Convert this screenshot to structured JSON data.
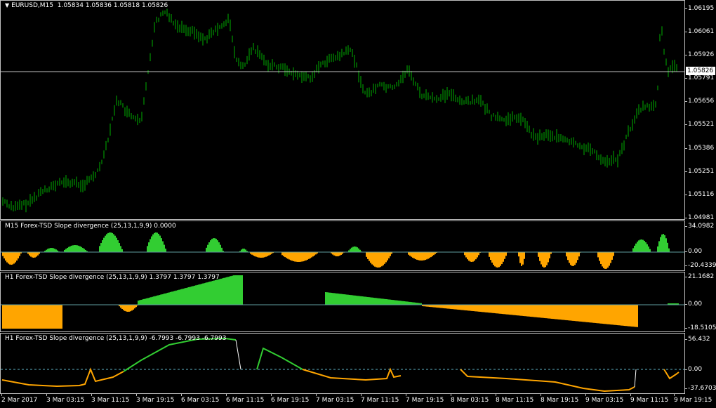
{
  "main_chart": {
    "symbol_label": "EURUSD,M15",
    "ohlc": "1.05834 1.05836 1.05818 1.05826",
    "current_price": "1.05826",
    "price_scale": [
      "1.06195",
      "1.06061",
      "1.05926",
      "1.05791",
      "1.05656",
      "1.05521",
      "1.05386",
      "1.05251",
      "1.05116",
      "1.04981"
    ],
    "colors": {
      "bars": "#00b000",
      "grid_line": "#c0c0c0"
    }
  },
  "indicator1": {
    "title": "M15 Forex-TSD Slope divergence (25,13,1,9,9) 0.0000",
    "scale": [
      "34.0982",
      "0.00",
      "-20.4339"
    ],
    "colors": {
      "positive": "#32cd32",
      "negative": "#ffa500"
    }
  },
  "indicator2": {
    "title": "H1 Forex-TSD Slope divergence (25,13,1,9,9) 1.3797 1.3797 1.3797",
    "scale": [
      "21.1682",
      "0.00",
      "-18.5105"
    ],
    "colors": {
      "positive": "#32cd32",
      "negative": "#ffa500"
    }
  },
  "indicator3": {
    "title": "H1 Forex-TSD Slope divergence (25,13,1,9,9) -6.7993 -6.7993 -6.7993",
    "scale": [
      "56.432",
      "0.00",
      "-37.6703"
    ],
    "colors": {
      "positive": "#32cd32",
      "negative": "#ffa500",
      "zero_line": "#5fb4c8"
    }
  },
  "time_axis": [
    "2 Mar 2017",
    "3 Mar 03:15",
    "3 Mar 11:15",
    "3 Mar 19:15",
    "6 Mar 03:15",
    "6 Mar 11:15",
    "6 Mar 19:15",
    "7 Mar 03:15",
    "7 Mar 11:15",
    "7 Mar 19:15",
    "8 Mar 03:15",
    "8 Mar 11:15",
    "8 Mar 19:15",
    "9 Mar 03:15",
    "9 Mar 11:15",
    "9 Mar 19:15"
  ]
}
